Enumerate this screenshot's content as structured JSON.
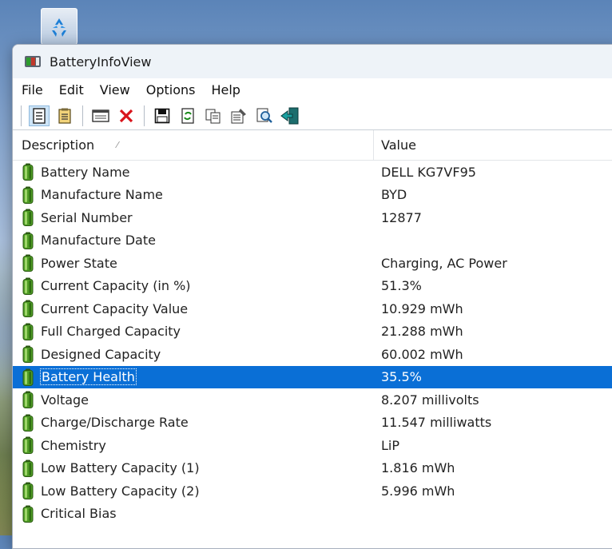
{
  "window": {
    "title": "BatteryInfoView"
  },
  "menu": [
    "File",
    "Edit",
    "View",
    "Options",
    "Help"
  ],
  "toolbar": {
    "buttons": [
      "properties-icon",
      "html-report-icon",
      "refresh-window-icon",
      "delete-icon",
      "save-icon",
      "refresh-icon",
      "copy-icon",
      "properties-sheet-icon",
      "find-icon",
      "exit-icon"
    ]
  },
  "columns": {
    "description": "Description",
    "sort_indicator": "⁄",
    "value": "Value"
  },
  "rows": [
    {
      "desc": "Battery Name",
      "value": "DELL KG7VF95"
    },
    {
      "desc": "Manufacture Name",
      "value": "BYD"
    },
    {
      "desc": "Serial Number",
      "value": "12877"
    },
    {
      "desc": "Manufacture Date",
      "value": ""
    },
    {
      "desc": "Power State",
      "value": "Charging, AC Power"
    },
    {
      "desc": "Current Capacity (in %)",
      "value": "51.3%"
    },
    {
      "desc": "Current Capacity Value",
      "value": "10.929 mWh"
    },
    {
      "desc": "Full Charged Capacity",
      "value": "21.288 mWh"
    },
    {
      "desc": "Designed Capacity",
      "value": "60.002 mWh"
    },
    {
      "desc": "Battery Health",
      "value": "35.5%",
      "selected": true
    },
    {
      "desc": "Voltage",
      "value": "8.207 millivolts"
    },
    {
      "desc": "Charge/Discharge Rate",
      "value": "11.547 milliwatts"
    },
    {
      "desc": "Chemistry",
      "value": "LiP"
    },
    {
      "desc": "Low Battery Capacity (1)",
      "value": "1.816 mWh"
    },
    {
      "desc": "Low Battery Capacity (2)",
      "value": "5.996 mWh"
    },
    {
      "desc": "Critical Bias",
      "value": ""
    }
  ],
  "colors": {
    "selection": "#0a6fd6",
    "battery_green": "#3f8f1f"
  }
}
